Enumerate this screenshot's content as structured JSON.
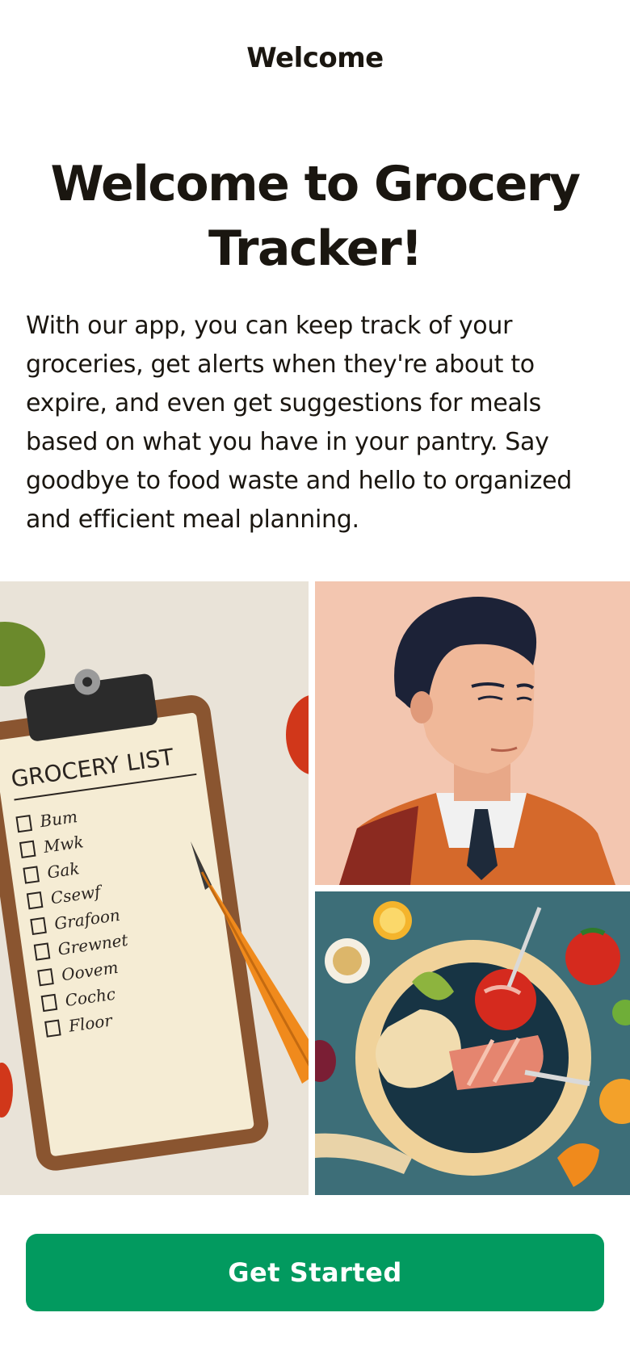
{
  "header": {
    "title": "Welcome"
  },
  "hero": {
    "headline": "Welcome to Grocery Tracker!",
    "description": "With our app, you can keep track of your groceries, get alerts when they're about to expire, and even get suggestions for meals based on what you have in your pantry. Say goodbye to food waste and hello to organized and efficient meal planning."
  },
  "gallery": {
    "list_image": {
      "title": "GROCERY LIST",
      "items": [
        "Bum",
        "Mwk",
        "Gak",
        "Csewf",
        "Grafoon",
        "Grewnet",
        "Oovem",
        "Cochc",
        "Floor"
      ]
    }
  },
  "cta": {
    "label": "Get Started"
  },
  "colors": {
    "accent": "#029a5f",
    "text": "#1a1610",
    "background": "#ffffff"
  }
}
